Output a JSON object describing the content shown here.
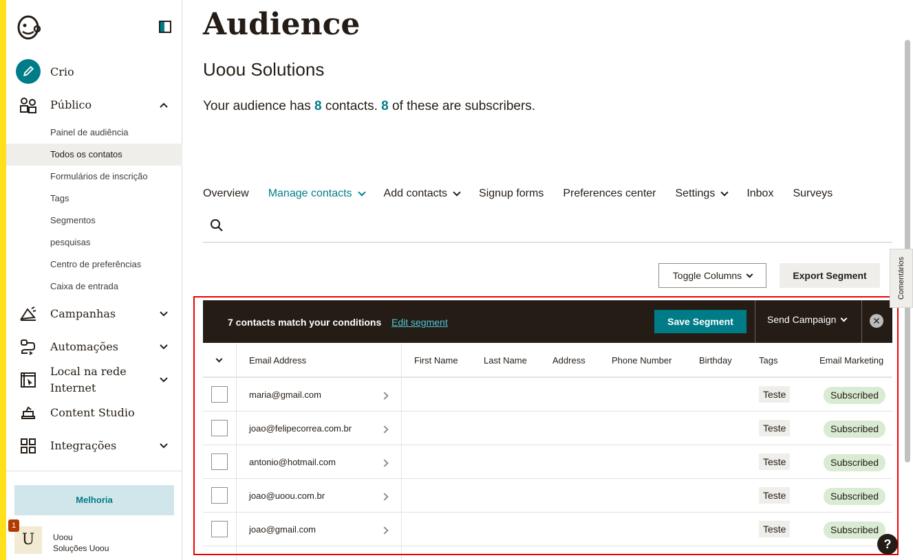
{
  "sidebar": {
    "create_label": "Crio",
    "audience_label": "Público",
    "audience_sub": [
      {
        "label": "Painel de audiência"
      },
      {
        "label": "Todos os contatos"
      },
      {
        "label": "Formulários de inscrição"
      },
      {
        "label": "Tags"
      },
      {
        "label": "Segmentos"
      },
      {
        "label": "pesquisas"
      },
      {
        "label": "Centro de preferências"
      },
      {
        "label": "Caixa de entrada"
      }
    ],
    "active_sub": "Todos os contatos",
    "campaigns_label": "Campanhas",
    "automations_label": "Automações",
    "website_label_line1": "Local na rede",
    "website_label_line2": "Internet",
    "content_studio_label": "Content Studio",
    "integrations_label": "Integrações",
    "upgrade_label": "Melhoria",
    "account": {
      "avatar_letter": "U",
      "notification_count": "1",
      "name": "Uoou",
      "org": "Soluções Uoou"
    }
  },
  "main": {
    "title": "Audience",
    "audience_name": "Uoou Solutions",
    "summary_prefix": "Your audience has ",
    "contacts_count": "8",
    "summary_middle": " contacts. ",
    "subscribers_count": "8",
    "summary_suffix": " of these are subscribers.",
    "tabs": [
      {
        "label": "Overview"
      },
      {
        "label": "Manage contacts"
      },
      {
        "label": "Add contacts"
      },
      {
        "label": "Signup forms"
      },
      {
        "label": "Preferences center"
      },
      {
        "label": "Settings"
      },
      {
        "label": "Inbox"
      },
      {
        "label": "Surveys"
      }
    ],
    "toggle_columns_label": "Toggle Columns",
    "export_segment_label": "Export Segment"
  },
  "segment_bar": {
    "match_text": "7 contacts match your conditions",
    "edit_label": "Edit segment",
    "save_label": "Save Segment",
    "send_campaign_label": "Send Campaign",
    "close_symbol": "✕"
  },
  "table": {
    "headers": [
      "Email Address",
      "First Name",
      "Last Name",
      "Address",
      "Phone Number",
      "Birthday",
      "Tags",
      "Email Marketing"
    ],
    "rows": [
      {
        "email": "maria@gmail.com",
        "tag": "Teste",
        "status": "Subscribed"
      },
      {
        "email": "joao@felipecorrea.com.br",
        "tag": "Teste",
        "status": "Subscribed"
      },
      {
        "email": "antonio@hotmail.com",
        "tag": "Teste",
        "status": "Subscribed"
      },
      {
        "email": "joao@uoou.com.br",
        "tag": "Teste",
        "status": "Subscribed"
      },
      {
        "email": "joao@gmail.com",
        "tag": "Teste",
        "status": "Subscribed"
      }
    ]
  },
  "feedback_label": "Comentários",
  "help_symbol": "?",
  "colors": {
    "brand_yellow": "#ffe01b",
    "accent_teal": "#007c89",
    "dark": "#241c15",
    "subscribed_bg": "#d9ebd2"
  }
}
